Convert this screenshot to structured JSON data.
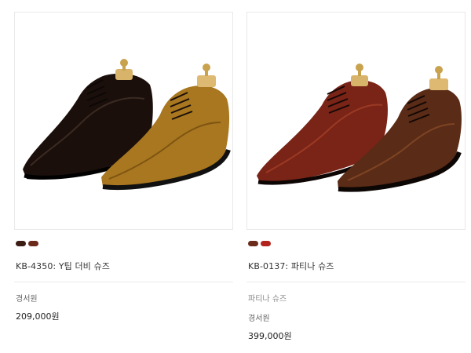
{
  "products": [
    {
      "swatches": [
        "#3b1d14",
        "#6b2a1a"
      ],
      "name": "KB-4350: Y팁 더비 슈즈",
      "brand": "경서원",
      "price": "209,000원"
    },
    {
      "swatches": [
        "#6b2a1a",
        "#b3231e"
      ],
      "name": "KB-0137: 파티나 슈즈",
      "subcategory": "파티나 슈즈",
      "brand": "경서원",
      "price": "399,000원"
    }
  ]
}
